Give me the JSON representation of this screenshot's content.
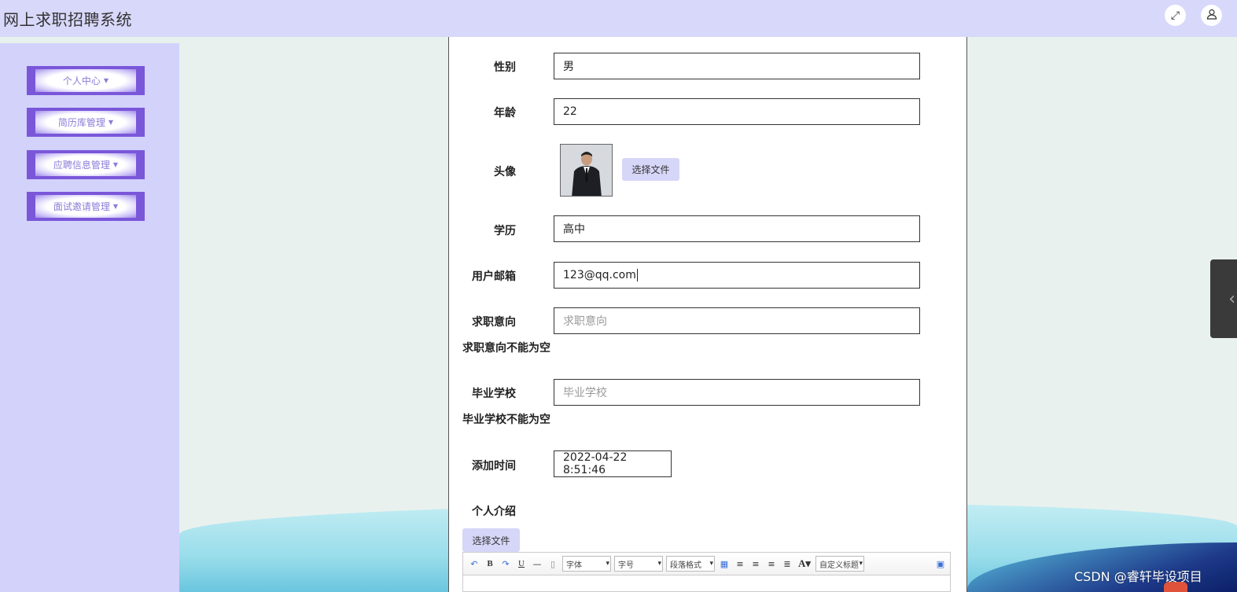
{
  "app": {
    "title": "网上求职招聘系统"
  },
  "header": {
    "fullscreen_icon": "expand-icon",
    "user_icon": "user-icon"
  },
  "sidebar": {
    "items": [
      {
        "label": "个人中心"
      },
      {
        "label": "简历库管理"
      },
      {
        "label": "应聘信息管理"
      },
      {
        "label": "面试邀请管理"
      }
    ]
  },
  "form": {
    "gender": {
      "label": "性别",
      "value": "男"
    },
    "age": {
      "label": "年龄",
      "value": "22"
    },
    "avatar": {
      "label": "头像",
      "button": "选择文件"
    },
    "education": {
      "label": "学历",
      "value": "高中"
    },
    "email": {
      "label": "用户邮箱",
      "value": "123@qq.com"
    },
    "job_intent": {
      "label": "求职意向",
      "placeholder": "求职意向",
      "error": "求职意向不能为空"
    },
    "school": {
      "label": "毕业学校",
      "placeholder": "毕业学校",
      "error": "毕业学校不能为空"
    },
    "add_time": {
      "label": "添加时间",
      "value": "2022-04-22 8:51:46"
    },
    "intro": {
      "label": "个人介绍",
      "button": "选择文件"
    }
  },
  "editor": {
    "font_select": "字体",
    "size_select": "字号",
    "paragraph_select": "段落格式",
    "custom_title_select": "自定义标题"
  },
  "watermark": "CSDN @睿轩毕设项目"
}
